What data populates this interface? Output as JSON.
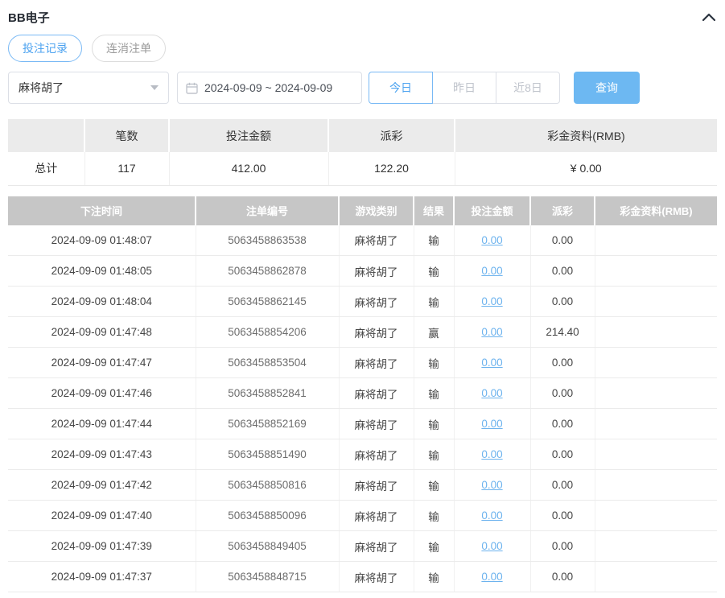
{
  "header": {
    "title": "BB电子",
    "collapse_icon": "chevron-up-icon"
  },
  "tabs": [
    {
      "label": "投注记录",
      "active": true
    },
    {
      "label": "连消注单",
      "active": false
    }
  ],
  "filters": {
    "game_select": {
      "value": "麻将胡了",
      "icon": "chevron-down-icon"
    },
    "date_range": {
      "value": "2024-09-09 ~ 2024-09-09",
      "icon": "calendar-icon"
    },
    "quick_buttons": [
      {
        "label": "今日",
        "active": true
      },
      {
        "label": "昨日",
        "active": false
      },
      {
        "label": "近8日",
        "active": false
      }
    ],
    "query_label": "查询"
  },
  "summary_table": {
    "headers": [
      "",
      "笔数",
      "投注金额",
      "派彩",
      "彩金资料(RMB)"
    ],
    "total_row": {
      "label": "总计",
      "count": "117",
      "bet_amount": "412.00",
      "payout": "122.20",
      "bonus": "¥ 0.00"
    }
  },
  "records_table": {
    "headers": [
      "下注时间",
      "注单编号",
      "游戏类别",
      "结果",
      "投注金额",
      "派彩",
      "彩金资料(RMB)"
    ],
    "rows": [
      {
        "time": "2024-09-09 01:48:07",
        "order_no": "5063458863538",
        "game": "麻将胡了",
        "result": "输",
        "bet": "0.00",
        "payout": "0.00",
        "bonus": ""
      },
      {
        "time": "2024-09-09 01:48:05",
        "order_no": "5063458862878",
        "game": "麻将胡了",
        "result": "输",
        "bet": "0.00",
        "payout": "0.00",
        "bonus": ""
      },
      {
        "time": "2024-09-09 01:48:04",
        "order_no": "5063458862145",
        "game": "麻将胡了",
        "result": "输",
        "bet": "0.00",
        "payout": "0.00",
        "bonus": ""
      },
      {
        "time": "2024-09-09 01:47:48",
        "order_no": "5063458854206",
        "game": "麻将胡了",
        "result": "赢",
        "bet": "0.00",
        "payout": "214.40",
        "bonus": ""
      },
      {
        "time": "2024-09-09 01:47:47",
        "order_no": "5063458853504",
        "game": "麻将胡了",
        "result": "输",
        "bet": "0.00",
        "payout": "0.00",
        "bonus": ""
      },
      {
        "time": "2024-09-09 01:47:46",
        "order_no": "5063458852841",
        "game": "麻将胡了",
        "result": "输",
        "bet": "0.00",
        "payout": "0.00",
        "bonus": ""
      },
      {
        "time": "2024-09-09 01:47:44",
        "order_no": "5063458852169",
        "game": "麻将胡了",
        "result": "输",
        "bet": "0.00",
        "payout": "0.00",
        "bonus": ""
      },
      {
        "time": "2024-09-09 01:47:43",
        "order_no": "5063458851490",
        "game": "麻将胡了",
        "result": "输",
        "bet": "0.00",
        "payout": "0.00",
        "bonus": ""
      },
      {
        "time": "2024-09-09 01:47:42",
        "order_no": "5063458850816",
        "game": "麻将胡了",
        "result": "输",
        "bet": "0.00",
        "payout": "0.00",
        "bonus": ""
      },
      {
        "time": "2024-09-09 01:47:40",
        "order_no": "5063458850096",
        "game": "麻将胡了",
        "result": "输",
        "bet": "0.00",
        "payout": "0.00",
        "bonus": ""
      },
      {
        "time": "2024-09-09 01:47:39",
        "order_no": "5063458849405",
        "game": "麻将胡了",
        "result": "输",
        "bet": "0.00",
        "payout": "0.00",
        "bonus": ""
      },
      {
        "time": "2024-09-09 01:47:37",
        "order_no": "5063458848715",
        "game": "麻将胡了",
        "result": "输",
        "bet": "0.00",
        "payout": "0.00",
        "bonus": ""
      }
    ]
  },
  "colors": {
    "accent_blue": "#4da3f0",
    "query_button_bg": "#6db8f2",
    "link_blue": "#6db3ee",
    "records_header_bg": "#c6c6c6",
    "summary_header_bg": "#ebebeb"
  }
}
